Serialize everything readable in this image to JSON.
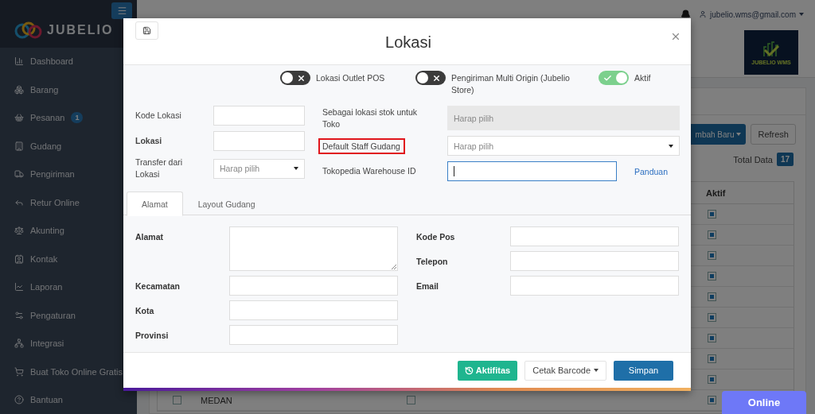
{
  "sidebar": {
    "brand": "JUBELIO",
    "items": [
      {
        "label": "Dashboard"
      },
      {
        "label": "Barang"
      },
      {
        "label": "Pesanan",
        "badge": "1"
      },
      {
        "label": "Gudang"
      },
      {
        "label": "Pengiriman"
      },
      {
        "label": "Retur Online"
      },
      {
        "label": "Akunting"
      },
      {
        "label": "Kontak"
      },
      {
        "label": "Laporan"
      },
      {
        "label": "Pengaturan"
      },
      {
        "label": "Integrasi"
      },
      {
        "label": "Buat Toko Online Gratis"
      },
      {
        "label": "Bantuan"
      }
    ]
  },
  "topbar": {
    "user": "jubelio.wms@gmail.com"
  },
  "brand_logo": {
    "text": "JUBELIO WMS"
  },
  "page": {
    "add_button": "mbah Baru",
    "refresh_button": "Refresh",
    "total_label": "Total Data",
    "total": "17",
    "table": {
      "columns": [
        "Aktif"
      ],
      "rows": [
        {
          "aktif": true
        },
        {
          "aktif": true
        },
        {
          "aktif": true
        },
        {
          "aktif": true
        },
        {
          "aktif": true
        },
        {
          "aktif": true
        },
        {
          "aktif": true
        },
        {
          "aktif": true
        },
        {
          "aktif": true
        },
        {
          "name": "MEDAN",
          "checked": false,
          "column_3_checked": false,
          "aktif": true
        }
      ]
    }
  },
  "modal": {
    "title": "Lokasi",
    "toggles": [
      {
        "label": "Lokasi Outlet POS",
        "on": false
      },
      {
        "label": "Pengiriman Multi Origin (Jubelio Store)",
        "on": false
      },
      {
        "label": "Aktif",
        "on": true
      }
    ],
    "left_fields": [
      {
        "label": "Kode Lokasi",
        "kind": "input",
        "bold": false
      },
      {
        "label": "Lokasi",
        "kind": "input",
        "bold": true
      },
      {
        "label": "Transfer dari Lokasi",
        "kind": "select",
        "placeholder": "Harap pilih",
        "bold": false
      }
    ],
    "right_fields": [
      {
        "label": "Sebagai lokasi stok untuk Toko",
        "kind": "select",
        "placeholder": "Harap pilih",
        "disabled": true,
        "highlighted": false
      },
      {
        "label": "Default Staff Gudang",
        "kind": "select",
        "placeholder": "Harap pilih",
        "disabled": false,
        "highlighted": true
      },
      {
        "label": "Tokopedia Warehouse ID",
        "kind": "input",
        "focused": true,
        "link": "Panduan",
        "disabled": false,
        "highlighted": false
      }
    ],
    "tabs": [
      {
        "label": "Alamat",
        "selected": true
      },
      {
        "label": "Layout Gudang",
        "selected": false
      }
    ],
    "address_left": [
      {
        "label": "Alamat",
        "kind": "textarea"
      },
      {
        "label": "Kecamatan",
        "kind": "input"
      },
      {
        "label": "Kota",
        "kind": "input"
      },
      {
        "label": "Provinsi",
        "kind": "input"
      }
    ],
    "address_right": [
      {
        "label": "Kode Pos",
        "kind": "input"
      },
      {
        "label": "Telepon",
        "kind": "input"
      },
      {
        "label": "Email",
        "kind": "input"
      }
    ],
    "footer": {
      "activity_button": "Aktifitas",
      "barcode_button": "Cetak Barcode",
      "save_button": "Simpan"
    }
  },
  "chat_button": "Online"
}
